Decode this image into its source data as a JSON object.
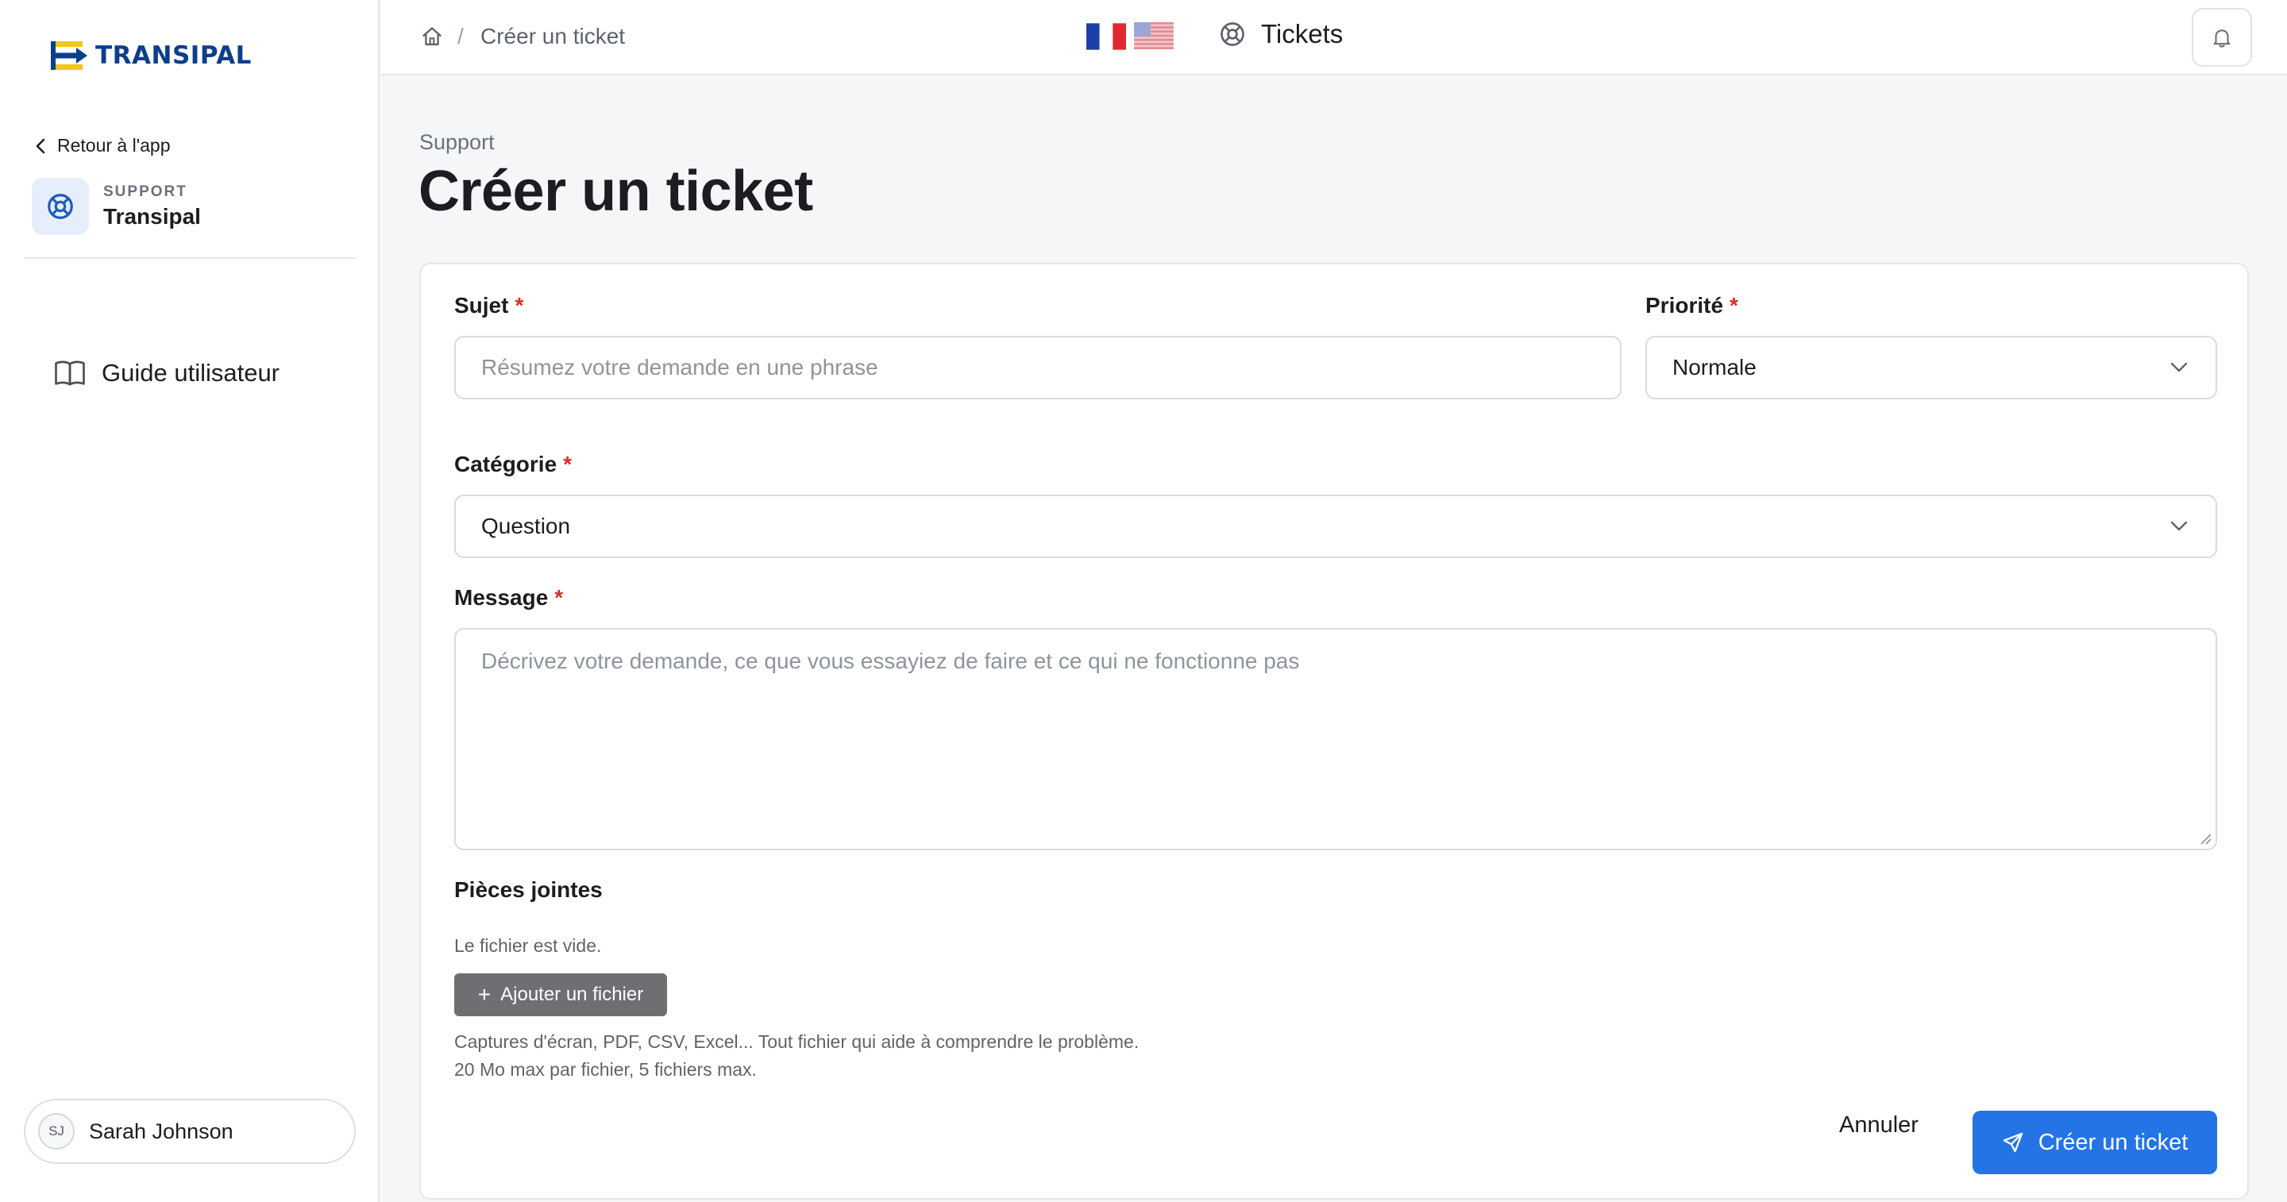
{
  "brand": {
    "name": "TRANSIPAL",
    "primary_color": "#0d3e8a",
    "accent_color": "#f5c518"
  },
  "sidebar": {
    "back_link": {
      "label": "Retour à l'app",
      "icon": "chevron-left-icon"
    },
    "support_card": {
      "tag": "SUPPORT",
      "name": "Transipal",
      "icon": "lifebuoy-icon"
    },
    "nav_items": [
      {
        "label": "Guide utilisateur",
        "icon": "book-open-icon"
      }
    ],
    "user": {
      "initials": "SJ",
      "name": "Sarah Johnson"
    }
  },
  "topbar": {
    "breadcrumb": {
      "home_icon": "home-icon",
      "separator": "/",
      "current": "Créer un ticket"
    },
    "languages": [
      {
        "code": "fr",
        "icon": "flag-fr-icon"
      },
      {
        "code": "en-us",
        "icon": "flag-us-icon"
      }
    ],
    "tickets_link": {
      "label": "Tickets",
      "icon": "lifebuoy-icon"
    },
    "notifications_icon": "bell-icon"
  },
  "page": {
    "overline": "Support",
    "title": "Créer un ticket"
  },
  "form": {
    "required_marker": "*",
    "subject": {
      "label": "Sujet",
      "placeholder": "Résumez votre demande en une phrase",
      "value": ""
    },
    "priority": {
      "label": "Priorité",
      "selected": "Normale"
    },
    "category": {
      "label": "Catégorie",
      "selected": "Question"
    },
    "message": {
      "label": "Message",
      "placeholder": "Décrivez votre demande, ce que vous essayiez de faire et ce qui ne fonctionne pas",
      "value": ""
    },
    "attachments": {
      "title": "Pièces jointes",
      "empty_text": "Le fichier est vide.",
      "add_label": "Ajouter un fichier",
      "hint_line1": "Captures d'écran, PDF, CSV, Excel... Tout fichier qui aide à comprendre le problème.",
      "hint_line2": "20 Mo max par fichier, 5 fichiers max."
    },
    "actions": {
      "cancel_label": "Annuler",
      "submit_label": "Créer un ticket",
      "submit_icon": "send-icon",
      "submit_color": "#2474e5"
    }
  }
}
